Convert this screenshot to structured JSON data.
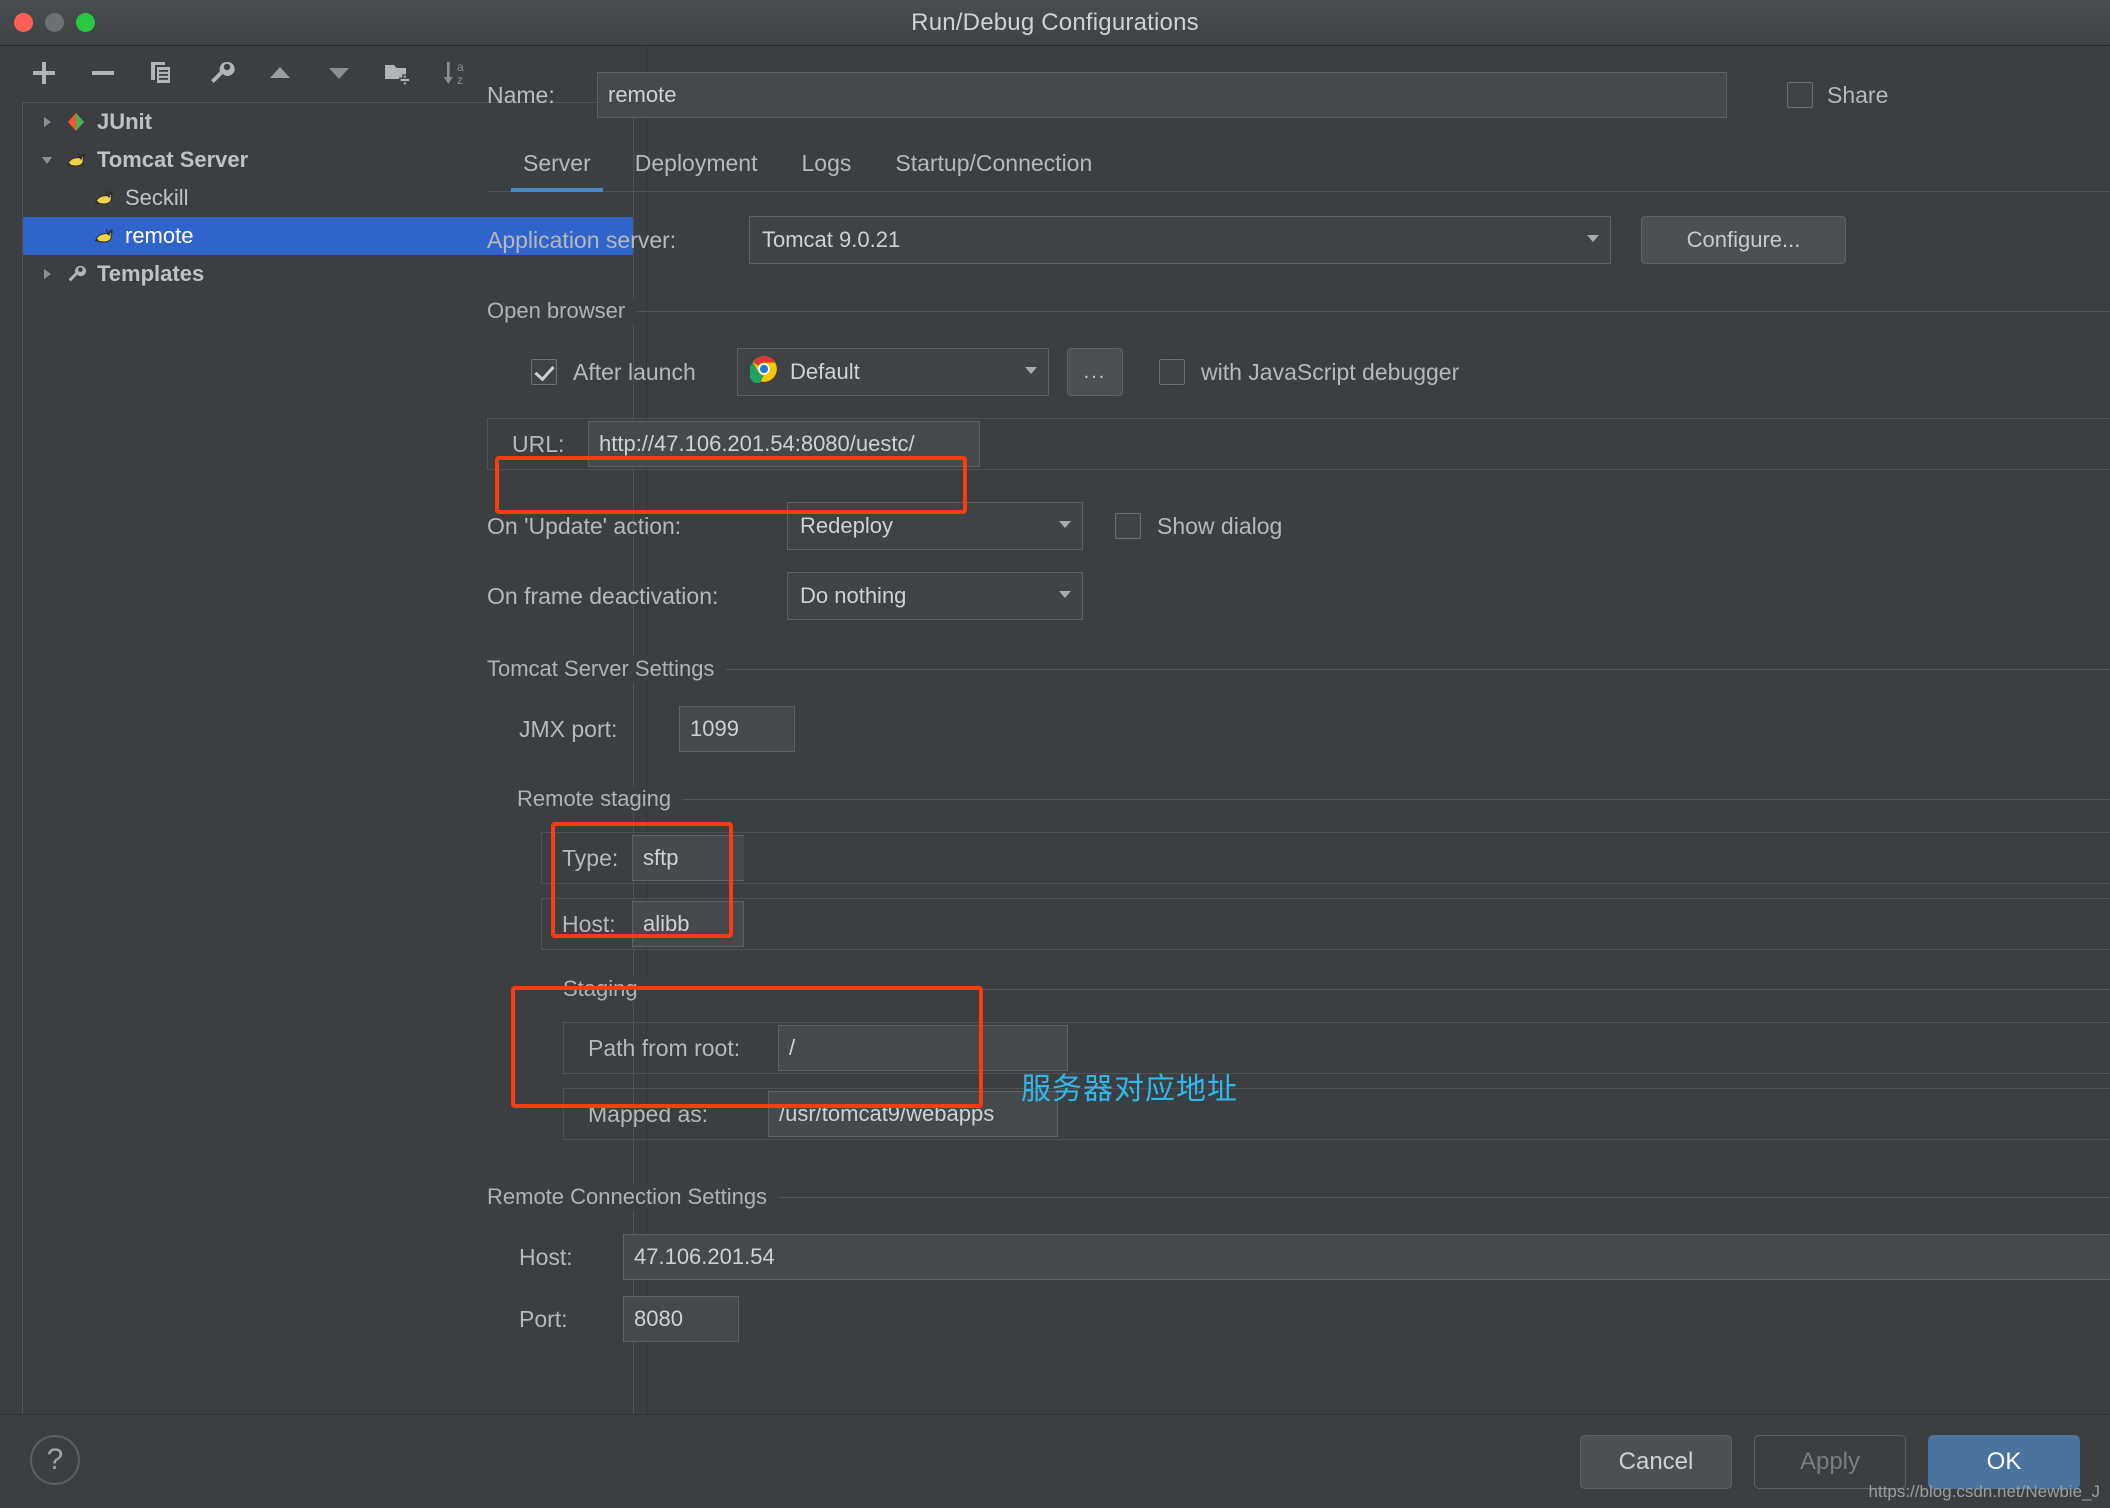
{
  "window": {
    "title": "Run/Debug Configurations",
    "traffic_lights": [
      "close",
      "minimize",
      "zoom"
    ]
  },
  "sidebar": {
    "toolbar": [
      {
        "name": "add-button",
        "icon": "plus-icon"
      },
      {
        "name": "remove-button",
        "icon": "minus-icon"
      },
      {
        "name": "copy-button",
        "icon": "copy-icon"
      },
      {
        "name": "edit-templates-button",
        "icon": "wrench-icon"
      },
      {
        "name": "move-up-button",
        "icon": "triangle-up-icon"
      },
      {
        "name": "move-down-button",
        "icon": "triangle-down-icon"
      },
      {
        "name": "new-folder-button",
        "icon": "folder-add-icon"
      },
      {
        "name": "sort-button",
        "icon": "sort-az-icon"
      }
    ],
    "tree": [
      {
        "label": "JUnit",
        "icon": "junit-icon",
        "expanded": false,
        "level": 0,
        "selected": false,
        "bold": true
      },
      {
        "label": "Tomcat Server",
        "icon": "tomcat-icon",
        "expanded": true,
        "level": 0,
        "selected": false,
        "bold": true
      },
      {
        "label": "Seckill",
        "icon": "tomcat-icon",
        "expanded": null,
        "level": 1,
        "selected": false,
        "bold": false
      },
      {
        "label": "remote",
        "icon": "tomcat-icon",
        "expanded": null,
        "level": 1,
        "selected": true,
        "bold": false
      },
      {
        "label": "Templates",
        "icon": "wrench-icon",
        "expanded": false,
        "level": 0,
        "selected": false,
        "bold": true
      }
    ]
  },
  "header": {
    "name_label": "Name:",
    "name_value": "remote",
    "share_label": "Share",
    "share_checked": false
  },
  "tabs": [
    {
      "label": "Server",
      "active": true
    },
    {
      "label": "Deployment",
      "active": false
    },
    {
      "label": "Logs",
      "active": false
    },
    {
      "label": "Startup/Connection",
      "active": false
    }
  ],
  "server_tab": {
    "application_server": {
      "label": "Application server:",
      "value": "Tomcat 9.0.21",
      "configure_button": "Configure..."
    },
    "open_browser": {
      "section_title": "Open browser",
      "after_launch_label": "After launch",
      "after_launch_checked": true,
      "browser_value": "Default",
      "browser_icon": "chrome-icon",
      "ellipsis_button": "...",
      "js_debugger_label": "with JavaScript debugger",
      "js_debugger_checked": false,
      "url_label": "URL:",
      "url_value": "http://47.106.201.54:8080/uestc/",
      "url_browse_icon": "folder-open-icon"
    },
    "on_update_action": {
      "label": "On 'Update' action:",
      "value": "Redeploy",
      "show_dialog_label": "Show dialog",
      "show_dialog_checked": false
    },
    "on_frame_deactivation": {
      "label": "On frame deactivation:",
      "value": "Do nothing"
    },
    "tomcat_server_settings": {
      "section_title": "Tomcat Server Settings",
      "jmx_port_label": "JMX port:",
      "jmx_port_value": "1099"
    },
    "remote_staging": {
      "section_title": "Remote staging",
      "type_label": "Type:",
      "type_value": "sftp",
      "host_label": "Host:",
      "host_value": "alibb",
      "host_ellipsis_button": "...",
      "staging_section_title": "Staging",
      "path_from_root_label": "Path from root:",
      "path_from_root_value": "/",
      "path_browse_icon": "folder-open-icon",
      "mapped_as_label": "Mapped as:",
      "mapped_as_value": "/usr/tomcat9/webapps",
      "annotation": "服务器对应地址"
    },
    "remote_connection_settings": {
      "section_title": "Remote Connection Settings",
      "host_label": "Host:",
      "host_value": "47.106.201.54",
      "port_label": "Port:",
      "port_value": "8080"
    }
  },
  "footer": {
    "help_glyph": "?",
    "cancel_label": "Cancel",
    "apply_label": "Apply",
    "apply_disabled": true,
    "ok_label": "OK",
    "watermark": "https://blog.csdn.net/Newbie_J"
  },
  "colors": {
    "accent_blue": "#4a88c7",
    "selection_blue": "#2f65ca",
    "primary_button": "#4a739e",
    "highlight_red": "#fb3b12",
    "annotation_cyan": "#2fb8ec",
    "window_bg": "#3c3f41"
  }
}
